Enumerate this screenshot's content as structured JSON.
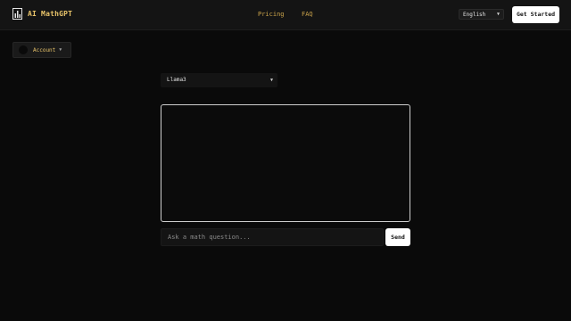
{
  "header": {
    "brand": {
      "icon": "bar-chart-icon",
      "title": "AI MathGPT"
    },
    "nav": {
      "pricing": "Pricing",
      "faq": "FAQ"
    },
    "language": {
      "value": "English",
      "icon": "chevron-down-icon"
    },
    "get_started": "Get Started"
  },
  "account": {
    "label": "Account",
    "icon": "chevron-down-icon"
  },
  "model_select": {
    "value": "Llama3",
    "icon": "chevron-down-icon"
  },
  "chat": {
    "placeholder": "Ask a math question...",
    "send_label": "Send"
  },
  "colors": {
    "background": "#0a0a0a",
    "accent": "#e9c46a",
    "button": "#ffffff"
  }
}
